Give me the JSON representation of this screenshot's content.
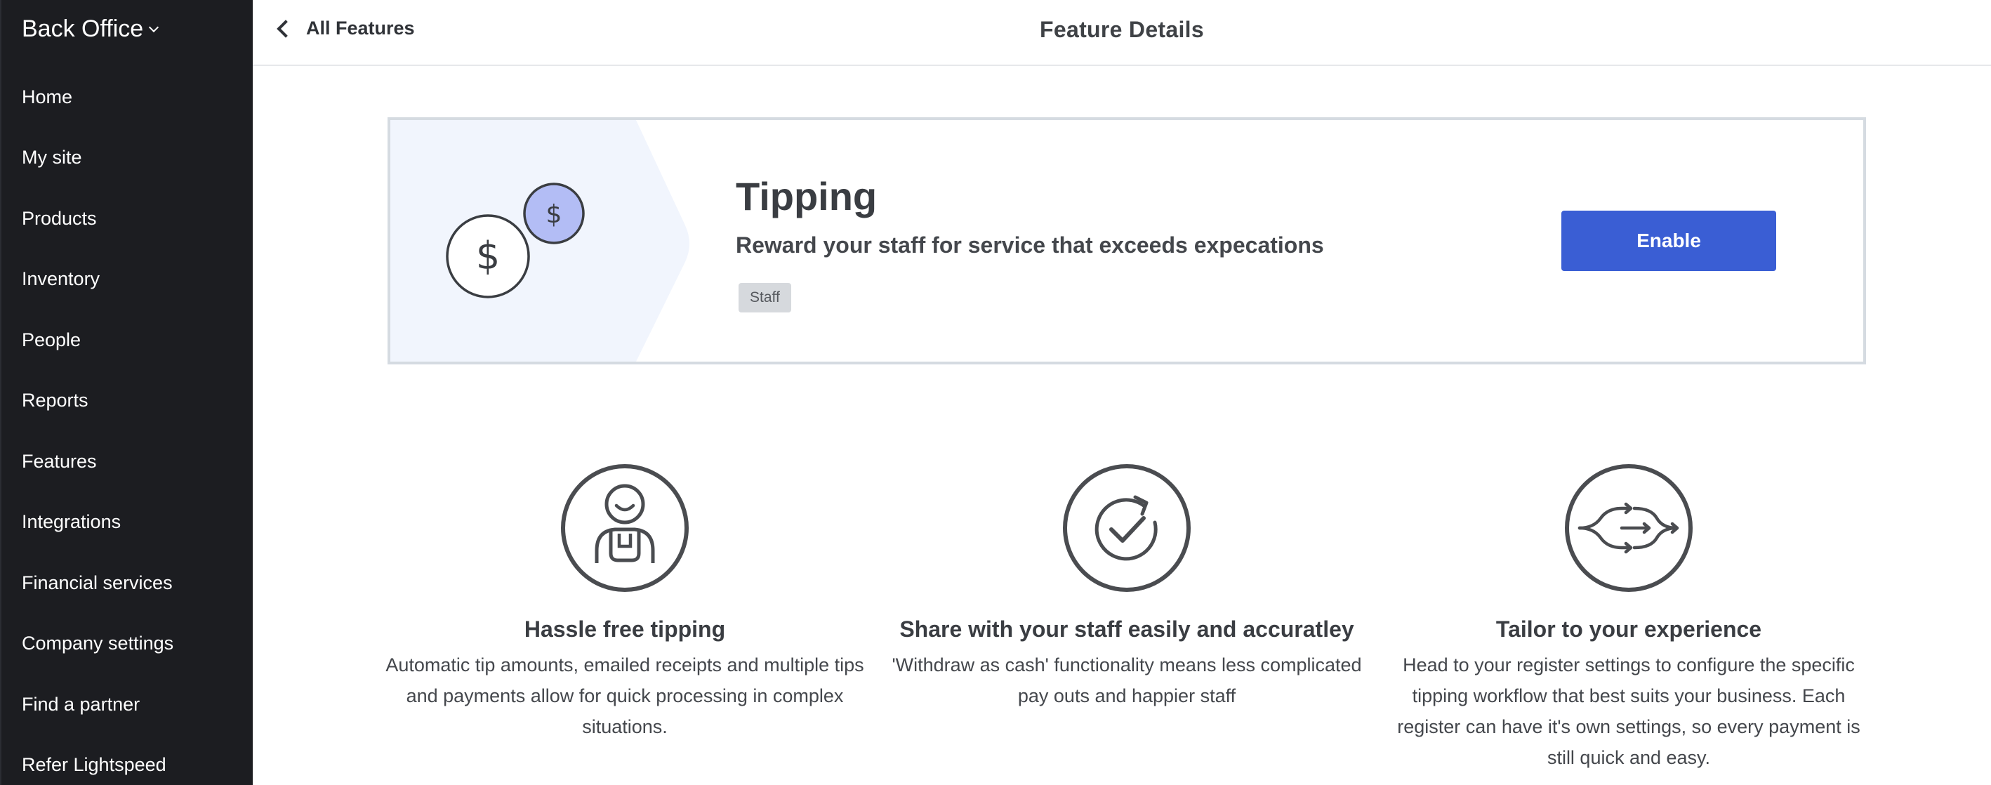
{
  "sidebar": {
    "brand": "Back Office",
    "items": [
      {
        "label": "Home"
      },
      {
        "label": "My site"
      },
      {
        "label": "Products"
      },
      {
        "label": "Inventory"
      },
      {
        "label": "People"
      },
      {
        "label": "Reports"
      },
      {
        "label": "Features"
      },
      {
        "label": "Integrations"
      },
      {
        "label": "Financial services"
      },
      {
        "label": "Company settings"
      },
      {
        "label": "Find a partner"
      },
      {
        "label": "Refer Lightspeed"
      }
    ]
  },
  "header": {
    "back_label": "All Features",
    "title": "Feature Details"
  },
  "feature": {
    "title": "Tipping",
    "subtitle": "Reward your staff for service that exceeds expecations",
    "tag": "Staff",
    "enable_label": "Enable",
    "art_symbols": [
      "$",
      "$"
    ]
  },
  "benefits": [
    {
      "icon": "person-icon",
      "title": "Hassle free tipping",
      "description": "Automatic tip amounts, emailed receipts and multiple tips and payments allow for quick processing in complex situations."
    },
    {
      "icon": "refresh-check-icon",
      "title": "Share with your staff easily and accuratley",
      "description": "'Withdraw as cash' functionality means less complicated pay outs and happier staff"
    },
    {
      "icon": "workflow-arrows-icon",
      "title": "Tailor to your experience",
      "description": "Head to your register settings to configure the specific tipping workflow that best suits your business. Each register can have it's own settings, so every payment is still quick and easy."
    }
  ],
  "colors": {
    "sidebar_bg": "#1c1d21",
    "primary_button": "#3a5ed4",
    "coin_accent": "#b3bdf5",
    "card_border": "#d5dbe1",
    "art_bg": "#f1f5fd"
  }
}
